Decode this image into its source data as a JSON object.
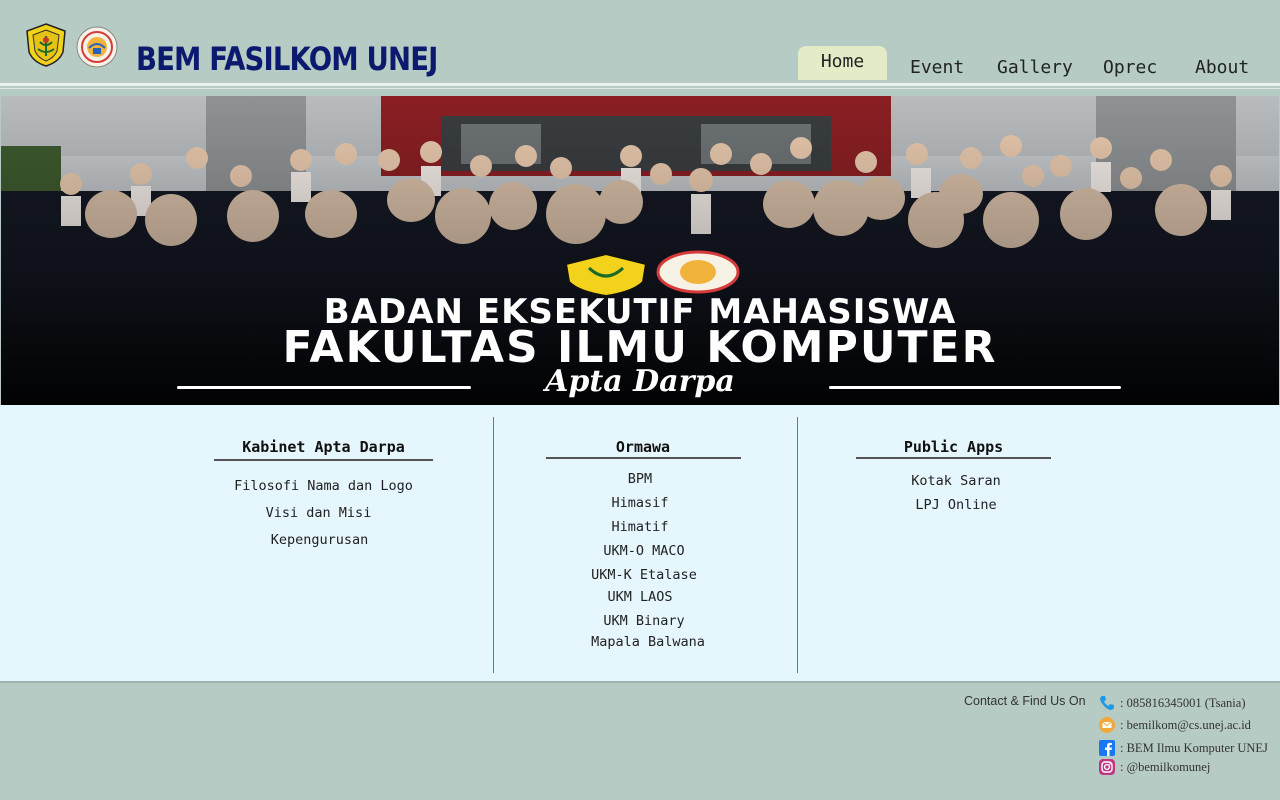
{
  "header": {
    "title": "BEM FASILKOM UNEJ",
    "nav": [
      {
        "label": "Home",
        "active": true
      },
      {
        "label": "Event"
      },
      {
        "label": "Gallery"
      },
      {
        "label": "Oprec"
      },
      {
        "label": "About"
      }
    ]
  },
  "banner": {
    "line1": "BADAN EKSEKUTIF MAHASISWA",
    "line2": "FAKULTAS ILMU KOMPUTER",
    "script": "Apta Darpa"
  },
  "columns": [
    {
      "heading": "Kabinet Apta Darpa",
      "links": [
        "Filosofi Nama dan Logo",
        "Visi dan Misi",
        "Kepengurusan"
      ]
    },
    {
      "heading": "Ormawa",
      "links": [
        "BPM",
        "Himasif",
        "Himatif",
        "UKM-O MACO",
        "UKM-K Etalase",
        "UKM LAOS",
        "UKM Binary",
        "Mapala Balwana"
      ]
    },
    {
      "heading": "Public Apps",
      "links": [
        "Kotak Saran",
        "LPJ Online"
      ]
    }
  ],
  "footer": {
    "contact_label": "Contact & Find Us On",
    "contacts": [
      {
        "icon": "phone-icon",
        "text": ": 085816345001 (Tsania)",
        "color": "#1e9be6"
      },
      {
        "icon": "email-icon",
        "text": ": bemilkom@cs.unej.ac.id",
        "color": "#f2a93b"
      },
      {
        "icon": "facebook-icon",
        "text": ": BEM Ilmu Komputer UNEJ",
        "color": "#1877f2"
      },
      {
        "icon": "instagram-icon",
        "text": ": @bemilkomunej",
        "color": "#c13584"
      }
    ]
  },
  "colors": {
    "header_bg": "#b5cbc3",
    "content_bg": "#e6f6fd",
    "title": "#0b1a6e",
    "active_tab": "#e3ecc6"
  }
}
